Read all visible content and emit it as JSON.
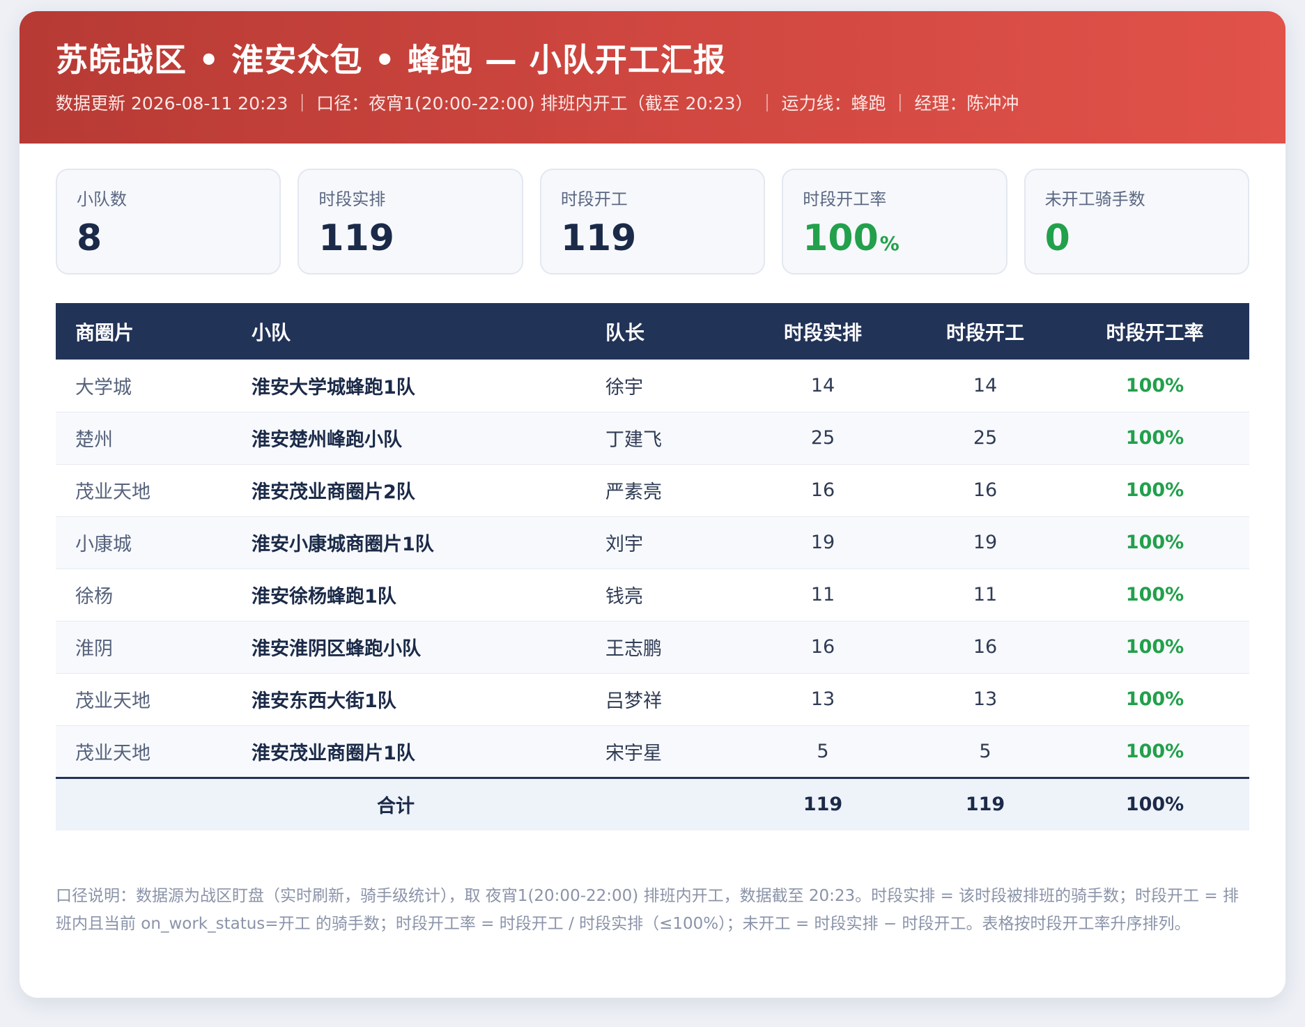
{
  "header": {
    "title": "苏皖战区 • 淮安众包 • 蜂跑 — 小队开工汇报",
    "meta": "数据更新 2026-08-11 20:23 ｜ 口径：夜宵1(20:00-22:00) 排班内开工（截至 20:23） ｜ 运力线：蜂跑 ｜ 经理：陈冲冲"
  },
  "kpis": [
    {
      "label": "小队数",
      "value": "8"
    },
    {
      "label": "时段实排",
      "value": "119"
    },
    {
      "label": "时段开工",
      "value": "119"
    },
    {
      "label": "时段开工率",
      "value": "100",
      "unit": "%"
    },
    {
      "label": "未开工骑手数",
      "value": "0"
    }
  ],
  "table": {
    "columns": [
      "商圈片",
      "小队",
      "队长",
      "时段实排",
      "时段开工",
      "时段开工率"
    ],
    "rows": [
      [
        "大学城",
        "淮安大学城蜂跑1队",
        "徐宇",
        "14",
        "14",
        "100%"
      ],
      [
        "楚州",
        "淮安楚州峰跑小队",
        "丁建飞",
        "25",
        "25",
        "100%"
      ],
      [
        "茂业天地",
        "淮安茂业商圈片2队",
        "严素亮",
        "16",
        "16",
        "100%"
      ],
      [
        "小康城",
        "淮安小康城商圈片1队",
        "刘宇",
        "19",
        "19",
        "100%"
      ],
      [
        "徐杨",
        "淮安徐杨蜂跑1队",
        "钱亮",
        "11",
        "11",
        "100%"
      ],
      [
        "淮阴",
        "淮安淮阴区蜂跑小队",
        "王志鹏",
        "16",
        "16",
        "100%"
      ],
      [
        "茂业天地",
        "淮安东西大街1队",
        "吕梦祥",
        "13",
        "13",
        "100%"
      ],
      [
        "茂业天地",
        "淮安茂业商圈片1队",
        "宋宇星",
        "5",
        "5",
        "100%"
      ]
    ],
    "total": {
      "label": "合计",
      "scheduled": "119",
      "started": "119",
      "rate": "100%"
    }
  },
  "footnote": "口径说明：数据源为战区盯盘（实时刷新，骑手级统计），取 夜宵1(20:00-22:00) 排班内开工，数据截至 20:23。时段实排 = 该时段被排班的骑手数；时段开工 = 排班内且当前 on_work_status=开工 的骑手数；时段开工率 = 时段开工 / 时段实排（≤100%）；未开工 = 时段实排 − 时段开工。表格按时段开工率升序排列。",
  "colors": {
    "header_red": "#cf4740",
    "navy": "#223358",
    "green": "#22a04b"
  }
}
